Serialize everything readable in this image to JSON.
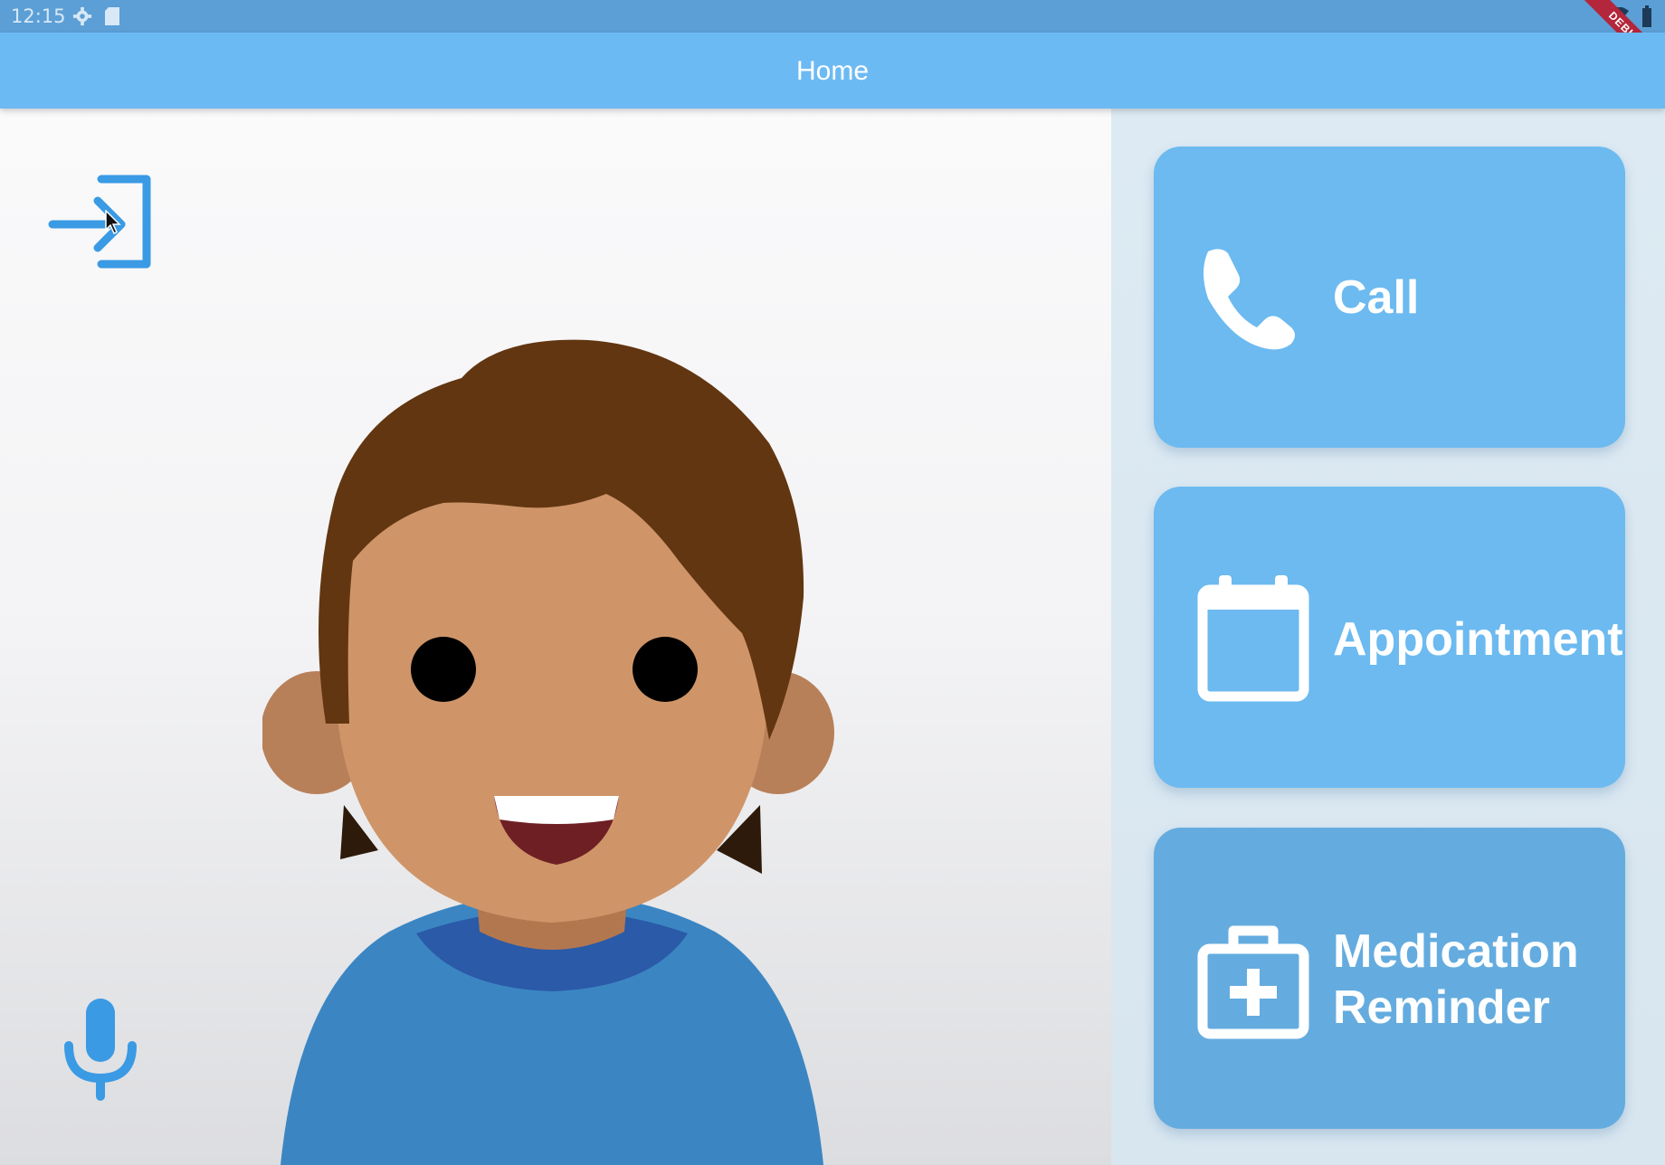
{
  "status_bar": {
    "time": "12:15",
    "debug_banner": "DEBUG"
  },
  "app_bar": {
    "title": "Home"
  },
  "menu": {
    "call": {
      "label": "Call",
      "icon": "phone-icon"
    },
    "appointment": {
      "label": "Appointment",
      "icon": "calendar-icon"
    },
    "medication": {
      "label_line1": "Medication",
      "label_line2": "Reminder",
      "icon": "medical-kit-icon"
    }
  },
  "icons": {
    "login": "login-icon",
    "microphone": "microphone-icon"
  },
  "colors": {
    "app_bar": "#6cbaf3",
    "card": "#6cbaf0",
    "icon_blue": "#3a9ae4",
    "hair": "#623611",
    "skin": "#cf9569",
    "shirt": "#3b86c2"
  }
}
